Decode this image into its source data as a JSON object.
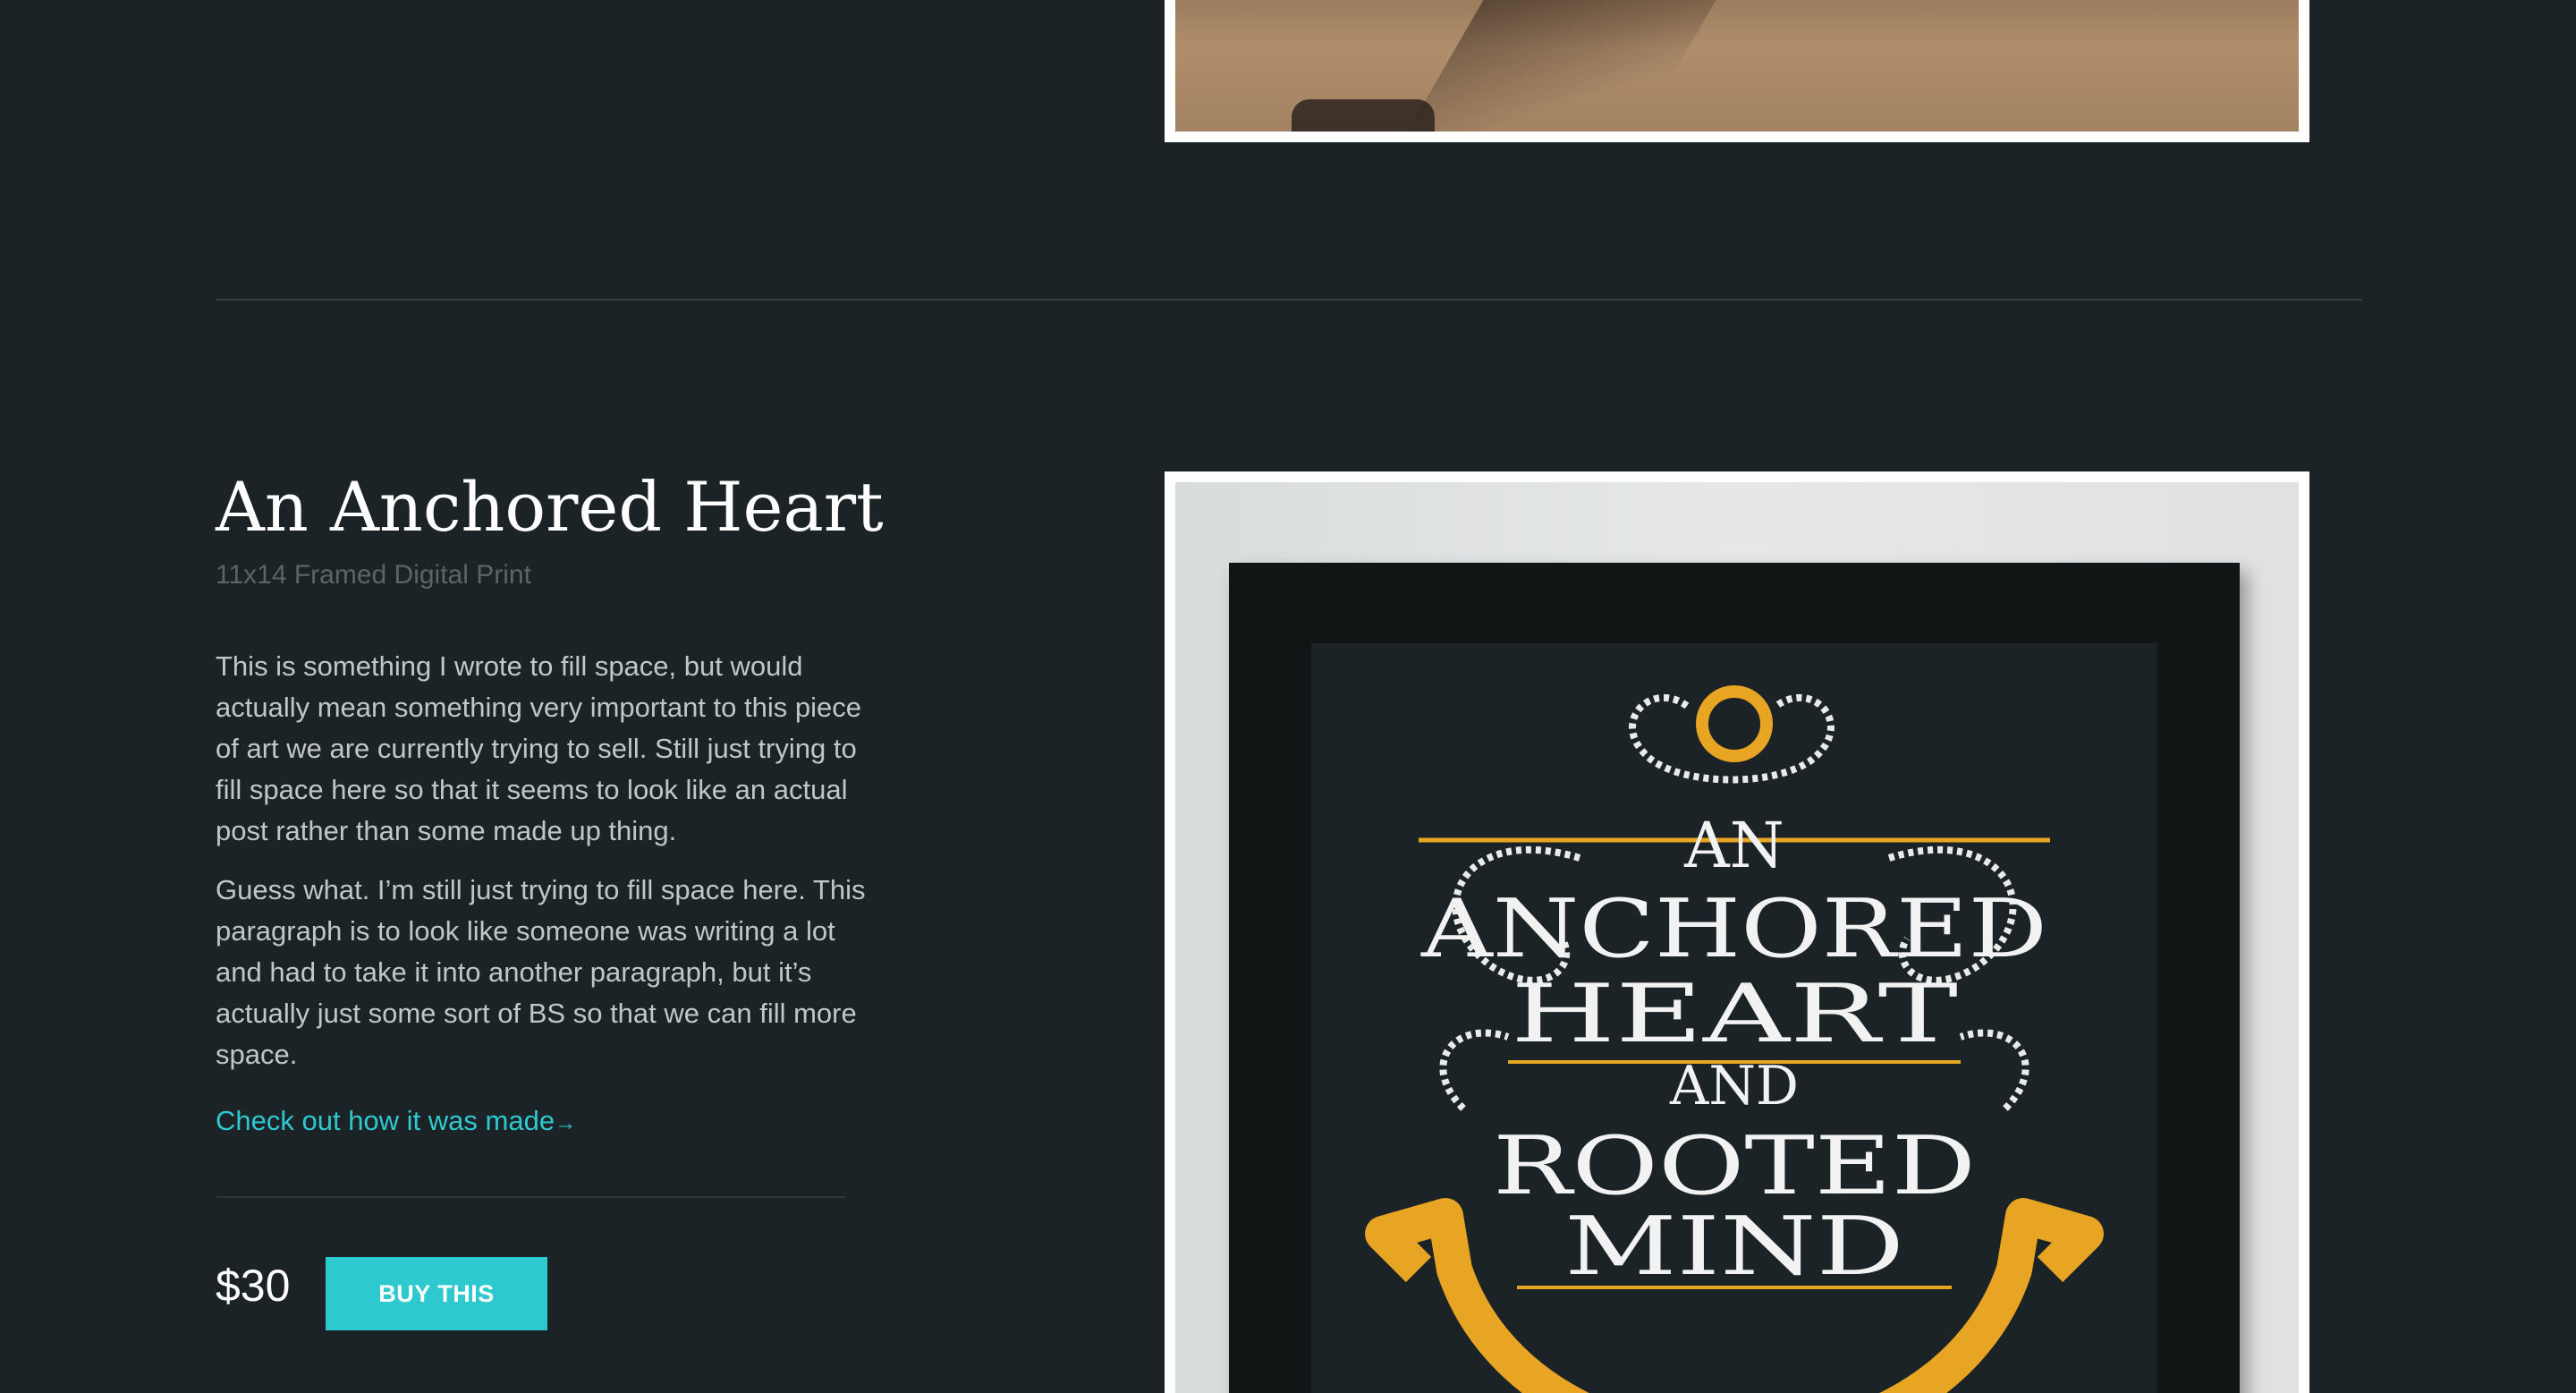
{
  "product": {
    "title": "An Anchored Heart",
    "subtitle": "11x14 Framed Digital Print",
    "paragraphs": [
      "This is something I wrote to fill space, but would actually mean something very important to this piece of art we are currently trying to sell. Still just trying to fill space here so that it seems to look like an actual post rather than some made up thing.",
      "Guess what. I’m still just trying to fill space here. This paragraph is to look like someone was writing a lot and had to take it into another paragraph, but it’s actually just some sort of BS so that we can fill more space."
    ],
    "link_label": "Check out how it was made",
    "link_arrow": "→",
    "price": "$30",
    "buy_label": "BUY THIS"
  },
  "artwork": {
    "lines": [
      "AN",
      "ANCHORED",
      "HEART",
      "AND",
      "ROOTED",
      "MIND"
    ]
  },
  "colors": {
    "background": "#1c2326",
    "accent": "#2ec8cf",
    "anchor_gold": "#e8a523",
    "text_light": "#c0c6c9",
    "text_muted": "#5b6569"
  }
}
